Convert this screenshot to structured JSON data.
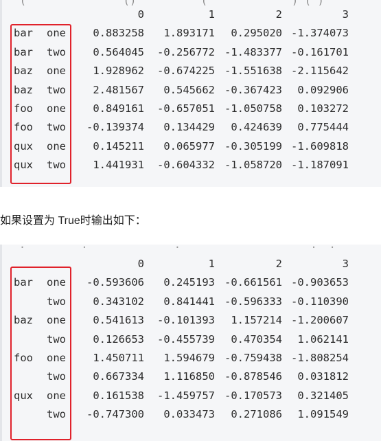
{
  "top_output": {
    "cut_line": "  (               ()          (             ) ( )",
    "columns": [
      "0",
      "1",
      "2",
      "3"
    ],
    "rows": [
      {
        "l0": "bar",
        "l1": "one",
        "v": [
          "0.883258",
          "1.893171",
          "0.295020",
          "-1.374073"
        ]
      },
      {
        "l0": "bar",
        "l1": "two",
        "v": [
          "0.564045",
          "-0.256772",
          "-1.483377",
          "-0.161701"
        ]
      },
      {
        "l0": "baz",
        "l1": "one",
        "v": [
          "1.928962",
          "-0.674225",
          "-1.551638",
          "-2.115642"
        ]
      },
      {
        "l0": "baz",
        "l1": "two",
        "v": [
          "2.481567",
          "0.545662",
          "-0.367423",
          "0.092906"
        ]
      },
      {
        "l0": "foo",
        "l1": "one",
        "v": [
          "0.849161",
          "-0.657051",
          "-1.050758",
          "0.103272"
        ]
      },
      {
        "l0": "foo",
        "l1": "two",
        "v": [
          "-0.139374",
          "0.134429",
          "0.424639",
          "0.775444"
        ]
      },
      {
        "l0": "qux",
        "l1": "one",
        "v": [
          "0.145211",
          "0.065977",
          "-0.305199",
          "-1.609818"
        ]
      },
      {
        "l0": "qux",
        "l1": "two",
        "v": [
          "1.441931",
          "-0.604332",
          "-1.058720",
          "-1.187091"
        ]
      }
    ]
  },
  "caption": "如果设置为 True时输出如下：",
  "bottom_output": {
    "cut_line": "  .         .              .  ' '             '  .  .",
    "columns": [
      "0",
      "1",
      "2",
      "3"
    ],
    "rows": [
      {
        "l0": "bar",
        "l1": "one",
        "v": [
          "-0.593606",
          "0.245193",
          "-0.661561",
          "-0.903653"
        ]
      },
      {
        "l0": "",
        "l1": "two",
        "v": [
          "0.343102",
          "0.841441",
          "-0.596333",
          "-0.110390"
        ]
      },
      {
        "l0": "baz",
        "l1": "one",
        "v": [
          "0.541613",
          "-0.101393",
          "1.157214",
          "-1.200607"
        ]
      },
      {
        "l0": "",
        "l1": "two",
        "v": [
          "0.126653",
          "-0.455739",
          "0.470354",
          "1.062141"
        ]
      },
      {
        "l0": "foo",
        "l1": "one",
        "v": [
          "1.450711",
          "1.594679",
          "-0.759438",
          "-1.808254"
        ]
      },
      {
        "l0": "",
        "l1": "two",
        "v": [
          "0.667334",
          "1.116850",
          "-0.878546",
          "0.031812"
        ]
      },
      {
        "l0": "qux",
        "l1": "one",
        "v": [
          "0.161538",
          "-1.459757",
          "-0.170573",
          "0.321405"
        ]
      },
      {
        "l0": "",
        "l1": "two",
        "v": [
          "-0.747300",
          "0.033473",
          "0.271086",
          "1.091549"
        ]
      }
    ]
  },
  "colors": {
    "highlight_box": "#e0222b",
    "code_background": "#f5f6f8",
    "code_text": "#2b2b2b"
  }
}
